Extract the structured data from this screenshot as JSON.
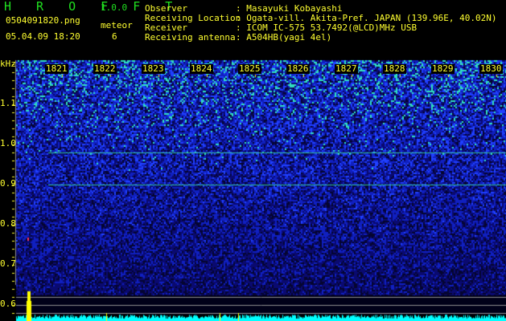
{
  "header": {
    "app_name": "H R O F F T",
    "version": "1.0.0",
    "filename": "0504091820.png",
    "datetime": "05.04.09 18:20",
    "meteor_label": "meteor",
    "meteor_count": "6"
  },
  "info": {
    "observer_label": "Observer",
    "observer_value": ": Masayuki Kobayashi",
    "location_label": "Receiving Location",
    "location_value": ": Ogata-vill. Akita-Pref. JAPAN (139.96E, 40.02N)",
    "receiver_label": "Receiver",
    "receiver_value": ": ICOM IC-575 53.7492(@LCD)MHz USB",
    "antenna_label": "Receiving antenna",
    "antenna_value": ": A504HB(yagi 4el)"
  },
  "axis": {
    "unit": "kHz",
    "freq_labels": [
      "1.1",
      "1.0",
      "0.9",
      "0.8",
      "0.7",
      "0.6"
    ],
    "time_labels": [
      "1821",
      "1822",
      "1823",
      "1824",
      "1825",
      "1826",
      "1827",
      "1828",
      "1829",
      "1830"
    ]
  },
  "colors": {
    "text": "#ffff30",
    "title": "#20e020",
    "histogram": "#00ffff",
    "spike": "#ffff00"
  }
}
